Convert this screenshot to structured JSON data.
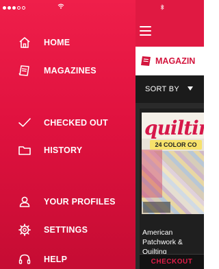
{
  "colors": {
    "drawer": "#e0123f",
    "accent": "#d3153d",
    "sort_bar": "#1b1b1b",
    "card_bg": "#1f1f1f"
  },
  "drawer": {
    "items": [
      {
        "label": "HOME",
        "icon": "home-icon"
      },
      {
        "label": "MAGAZINES",
        "icon": "magazine-icon"
      },
      {
        "label": "CHECKED OUT",
        "icon": "checkmark-icon"
      },
      {
        "label": "HISTORY",
        "icon": "folder-icon"
      },
      {
        "label": "YOUR PROFILES",
        "icon": "person-icon"
      },
      {
        "label": "SETTINGS",
        "icon": "gear-icon"
      },
      {
        "label": "HELP",
        "icon": "headset-icon"
      }
    ]
  },
  "content": {
    "section_title": "MAGAZIN",
    "sort_label": "SORT BY",
    "card": {
      "cover": {
        "masthead": "quilting",
        "badge": "24 COLOR CO"
      },
      "title": "American Patchwork & Quilting",
      "action": "CHECKOUT"
    }
  }
}
